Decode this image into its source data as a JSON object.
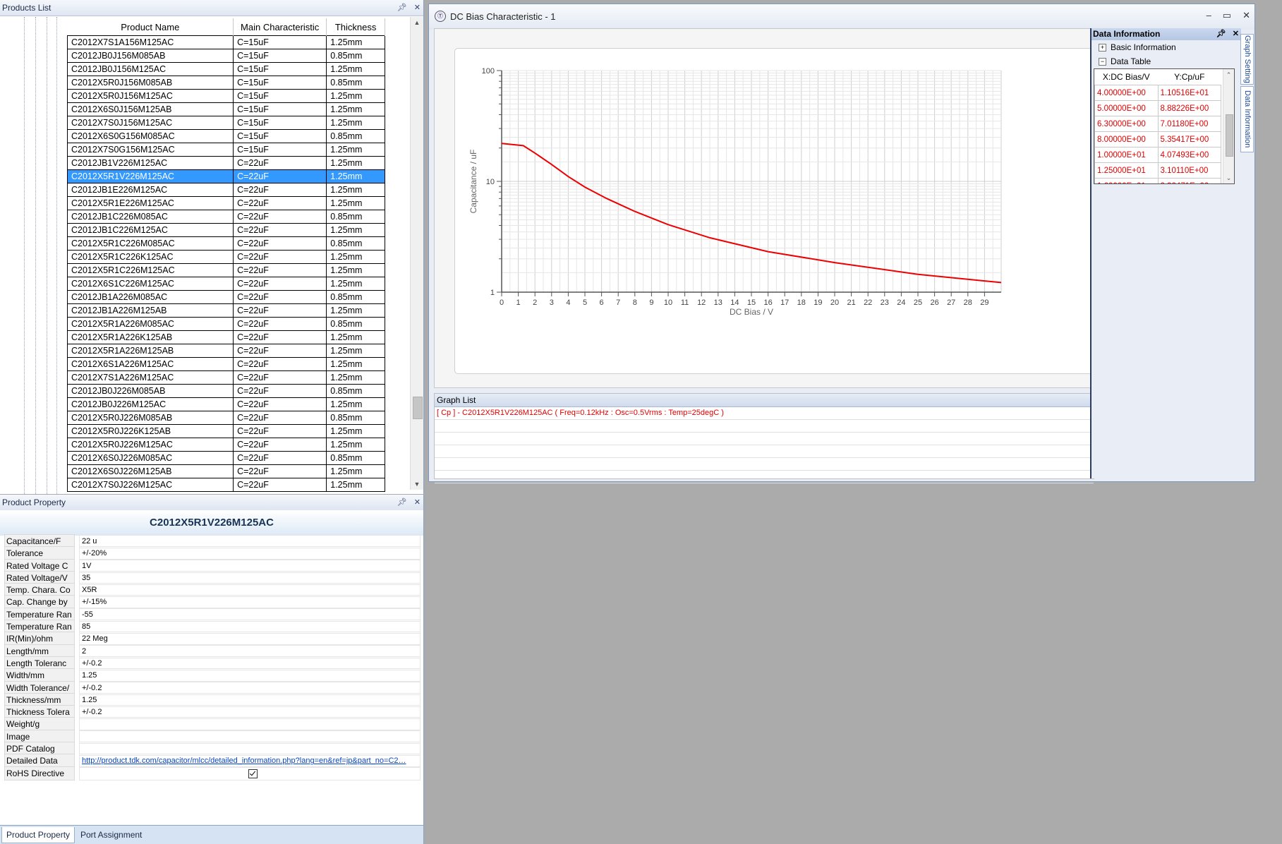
{
  "products_panel": {
    "title": "Products List",
    "columns": [
      "Product Name",
      "Main Characteristic",
      "Thickness"
    ],
    "rows": [
      [
        "C2012X7S1A156M125AC",
        "C=15uF",
        "1.25mm"
      ],
      [
        "C2012JB0J156M085AB",
        "C=15uF",
        "0.85mm"
      ],
      [
        "C2012JB0J156M125AC",
        "C=15uF",
        "1.25mm"
      ],
      [
        "C2012X5R0J156M085AB",
        "C=15uF",
        "0.85mm"
      ],
      [
        "C2012X5R0J156M125AC",
        "C=15uF",
        "1.25mm"
      ],
      [
        "C2012X6S0J156M125AB",
        "C=15uF",
        "1.25mm"
      ],
      [
        "C2012X7S0J156M125AC",
        "C=15uF",
        "1.25mm"
      ],
      [
        "C2012X6S0G156M085AC",
        "C=15uF",
        "0.85mm"
      ],
      [
        "C2012X7S0G156M125AC",
        "C=15uF",
        "1.25mm"
      ],
      [
        "C2012JB1V226M125AC",
        "C=22uF",
        "1.25mm"
      ],
      [
        "C2012X5R1V226M125AC",
        "C=22uF",
        "1.25mm"
      ],
      [
        "C2012JB1E226M125AC",
        "C=22uF",
        "1.25mm"
      ],
      [
        "C2012X5R1E226M125AC",
        "C=22uF",
        "1.25mm"
      ],
      [
        "C2012JB1C226M085AC",
        "C=22uF",
        "0.85mm"
      ],
      [
        "C2012JB1C226M125AC",
        "C=22uF",
        "1.25mm"
      ],
      [
        "C2012X5R1C226M085AC",
        "C=22uF",
        "0.85mm"
      ],
      [
        "C2012X5R1C226K125AC",
        "C=22uF",
        "1.25mm"
      ],
      [
        "C2012X5R1C226M125AC",
        "C=22uF",
        "1.25mm"
      ],
      [
        "C2012X6S1C226M125AC",
        "C=22uF",
        "1.25mm"
      ],
      [
        "C2012JB1A226M085AC",
        "C=22uF",
        "0.85mm"
      ],
      [
        "C2012JB1A226M125AB",
        "C=22uF",
        "1.25mm"
      ],
      [
        "C2012X5R1A226M085AC",
        "C=22uF",
        "0.85mm"
      ],
      [
        "C2012X5R1A226K125AB",
        "C=22uF",
        "1.25mm"
      ],
      [
        "C2012X5R1A226M125AB",
        "C=22uF",
        "1.25mm"
      ],
      [
        "C2012X6S1A226M125AC",
        "C=22uF",
        "1.25mm"
      ],
      [
        "C2012X7S1A226M125AC",
        "C=22uF",
        "1.25mm"
      ],
      [
        "C2012JB0J226M085AB",
        "C=22uF",
        "0.85mm"
      ],
      [
        "C2012JB0J226M125AC",
        "C=22uF",
        "1.25mm"
      ],
      [
        "C2012X5R0J226M085AB",
        "C=22uF",
        "0.85mm"
      ],
      [
        "C2012X5R0J226K125AB",
        "C=22uF",
        "1.25mm"
      ],
      [
        "C2012X5R0J226M125AC",
        "C=22uF",
        "1.25mm"
      ],
      [
        "C2012X6S0J226M085AC",
        "C=22uF",
        "0.85mm"
      ],
      [
        "C2012X6S0J226M125AB",
        "C=22uF",
        "1.25mm"
      ],
      [
        "C2012X7S0J226M125AC",
        "C=22uF",
        "1.25mm"
      ]
    ],
    "selected_row": "C2012X5R1V226M125AC"
  },
  "property_panel": {
    "title": "Product Property",
    "heading": "C2012X5R1V226M125AC",
    "rows": [
      {
        "key": "Capacitance/F",
        "value": "22 u"
      },
      {
        "key": "Tolerance",
        "value": "+/-20%"
      },
      {
        "key": "Rated Voltage C",
        "value": "1V"
      },
      {
        "key": "Rated Voltage/V",
        "value": "35"
      },
      {
        "key": "Temp. Chara. Co",
        "value": "X5R"
      },
      {
        "key": "Cap. Change by",
        "value": "+/-15%"
      },
      {
        "key": "Temperature Ran",
        "value": "-55"
      },
      {
        "key": "Temperature Ran",
        "value": "85"
      },
      {
        "key": "IR(Min)/ohm",
        "value": "22 Meg"
      },
      {
        "key": "Length/mm",
        "value": "2"
      },
      {
        "key": "Length Toleranc",
        "value": "+/-0.2"
      },
      {
        "key": "Width/mm",
        "value": "1.25"
      },
      {
        "key": "Width Tolerance/",
        "value": "+/-0.2"
      },
      {
        "key": "Thickness/mm",
        "value": "1.25"
      },
      {
        "key": "Thickness Tolera",
        "value": "+/-0.2"
      },
      {
        "key": "Weight/g",
        "value": ""
      },
      {
        "key": "Image",
        "value": ""
      },
      {
        "key": "PDF Catalog",
        "value": ""
      },
      {
        "key": "Detailed Data",
        "value": "http://product.tdk.com/capacitor/mlcc/detailed_information.php?lang=en&ref=jp&part_no=C2…",
        "link": true
      },
      {
        "key": "RoHS Directive",
        "value": "",
        "checkbox": true
      }
    ],
    "tabs": [
      "Product Property",
      "Port Assignment"
    ],
    "active_tab": "Product Property"
  },
  "dc_window": {
    "title": "DC Bias Characteristic - 1",
    "graph_list": {
      "title": "Graph List",
      "entries": [
        "[ Cp ] - C2012X5R1V226M125AC ( Freq=0.12kHz : Osc=0.5Vrms : Temp=25degC )"
      ]
    },
    "data_info": {
      "title": "Data Information",
      "basic_info_label": "Basic Information",
      "data_table_label": "Data Table",
      "columns": [
        "X:DC Bias/V",
        "Y:Cp/uF"
      ],
      "rows": [
        [
          "4.00000E+00",
          "1.10516E+01"
        ],
        [
          "5.00000E+00",
          "8.88226E+00"
        ],
        [
          "6.30000E+00",
          "7.01180E+00"
        ],
        [
          "8.00000E+00",
          "5.35417E+00"
        ],
        [
          "1.00000E+01",
          "4.07493E+00"
        ],
        [
          "1.25000E+01",
          "3.10110E+00"
        ],
        [
          "1.60000E+01",
          "2.32471E+00"
        ]
      ]
    },
    "side_tabs": [
      "Graph Setting",
      "Data Information"
    ]
  },
  "chart_data": {
    "type": "line",
    "xlabel": "DC Bias / V",
    "ylabel": "Capacitance / uF",
    "x_scale": "linear",
    "y_scale": "log",
    "xlim": [
      0,
      30
    ],
    "ylim": [
      1,
      100
    ],
    "x_ticks": [
      0,
      1,
      2,
      3,
      4,
      5,
      6,
      7,
      8,
      9,
      10,
      11,
      12,
      13,
      14,
      15,
      16,
      17,
      18,
      19,
      20,
      21,
      22,
      23,
      24,
      25,
      26,
      27,
      28,
      29
    ],
    "y_ticks": [
      "1",
      "10",
      "100"
    ],
    "grid": true,
    "series": [
      {
        "color": "#ee0000",
        "x": [
          0,
          1.3,
          2,
          3,
          4,
          5,
          6.3,
          8,
          10,
          12.5,
          16,
          20,
          25,
          30
        ],
        "y": [
          22,
          21,
          18,
          14.2,
          11.05,
          8.88,
          7.01,
          5.35,
          4.07,
          3.1,
          2.32,
          1.85,
          1.45,
          1.22
        ]
      }
    ]
  }
}
